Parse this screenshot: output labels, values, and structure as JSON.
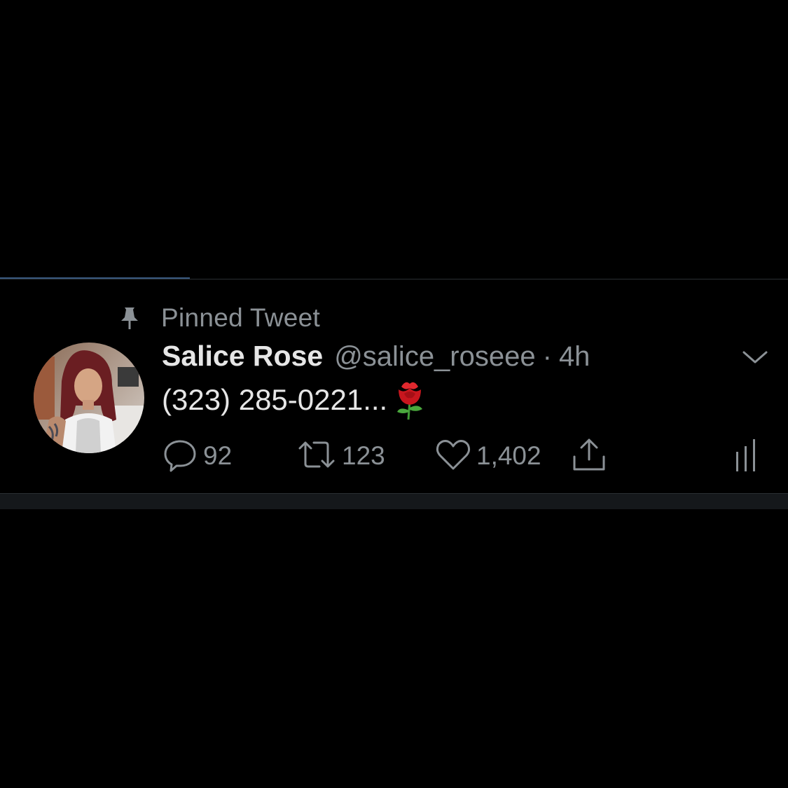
{
  "pinned": {
    "label": "Pinned Tweet",
    "icon": "pin-icon"
  },
  "tweet": {
    "display_name": "Salice Rose",
    "handle": "@salice_roseee",
    "separator": "·",
    "time": "4h",
    "text": "(323) 285-0221...",
    "emoji": "rose-emoji"
  },
  "actions": {
    "reply_count": "92",
    "retweet_count": "123",
    "like_count": "1,402"
  },
  "colors": {
    "background": "#000000",
    "secondary_text": "#8b9196",
    "primary_text": "#e6e6e6",
    "tab_indicator": "#3a5a80"
  }
}
